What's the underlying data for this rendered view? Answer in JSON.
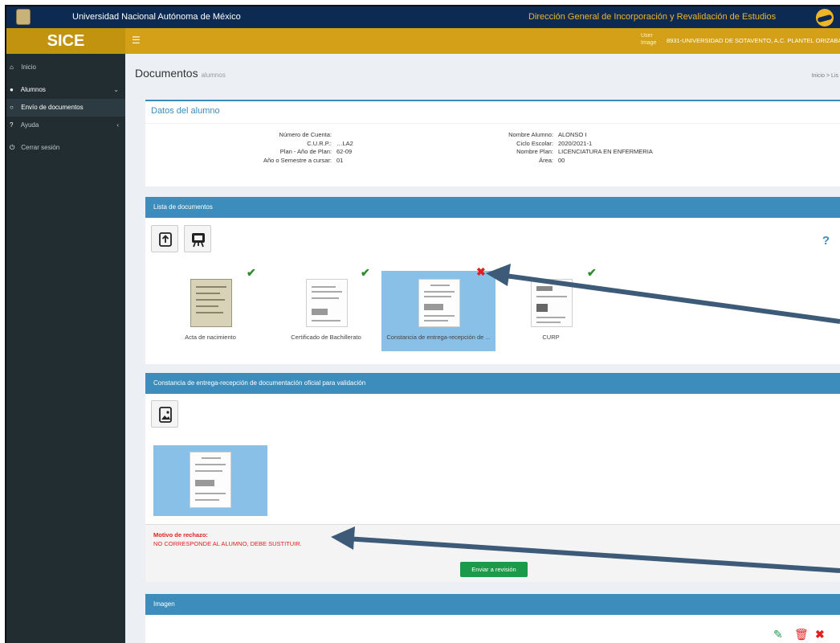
{
  "topbar": {
    "university": "Universidad Nacional Autónoma de México",
    "directorate": "Dirección General de Incorporación y Revalidación de Estudios"
  },
  "header": {
    "brand": "SICE",
    "menu_icon": "hamburger-icon",
    "user_image_alt": "User Image",
    "school": "8931-UNIVERSIDAD DE SOTAVENTO, A.C. PLANTEL ORIZABA"
  },
  "sidebar": {
    "items": [
      {
        "label": "Inicio",
        "icon": "home-icon"
      },
      {
        "label": "Alumnos",
        "icon": "users-icon"
      },
      {
        "label": "Envío de documentos",
        "icon": "circle-icon"
      },
      {
        "label": "Ayuda",
        "icon": "question-icon"
      },
      {
        "label": "Cerrar sesión",
        "icon": "power-icon"
      }
    ]
  },
  "page": {
    "title": "Documentos",
    "subtitle": "alumnos",
    "breadcrumb": [
      "Inicio",
      "Lis"
    ]
  },
  "datos": {
    "title": "Datos del alumno",
    "left": [
      {
        "label": "Número de Cuenta:",
        "value": ""
      },
      {
        "label": "C.U.R.P.:",
        "value": "…LA2"
      },
      {
        "label": "Plan - Año de Plan:",
        "value": "62-09"
      },
      {
        "label": "Año o Semestre a cursar:",
        "value": "01"
      }
    ],
    "right": [
      {
        "label": "Nombre Alumno:",
        "value": "ALONSO I"
      },
      {
        "label": "Ciclo Escolar:",
        "value": "2020/2021-1"
      },
      {
        "label": "Nombre Plan:",
        "value": "LICENCIATURA EN ENFERMERIA"
      },
      {
        "label": "Área:",
        "value": "00"
      }
    ]
  },
  "lista": {
    "title": "Lista de documentos",
    "help": "?",
    "docs": [
      {
        "name": "Acta de nacimiento",
        "status": "ok"
      },
      {
        "name": "Certificado de Bachillerato",
        "status": "ok"
      },
      {
        "name": "Constancia de entrega-recepción de ...",
        "status": "rejected"
      },
      {
        "name": "CURP",
        "status": "ok"
      }
    ]
  },
  "constancia": {
    "title": "Constancia de entrega-recepción de documentación oficial para validación",
    "motivo_label": "Motivo de rechazo:",
    "motivo_value": "NO CORRESPONDE AL ALUMNO, DEBE SUSTITUIR.",
    "send_label": "Enviar a revisión"
  },
  "imagen": {
    "title": "Imagen"
  },
  "colors": {
    "navy": "#0d2b52",
    "gold": "#d4a017",
    "blue": "#3c8dbc",
    "green": "#1b9a4a",
    "red": "#e02020",
    "arrow": "#3d5a78"
  }
}
